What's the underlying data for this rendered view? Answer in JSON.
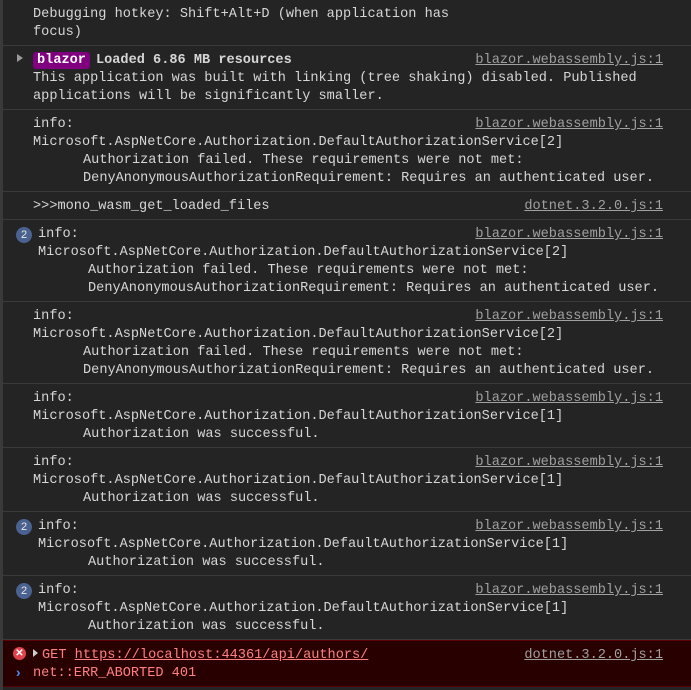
{
  "rows": [
    {
      "lines": [
        {
          "t": "Debugging hotkey: Shift+Alt+D (when application has"
        },
        {
          "t": "focus)"
        }
      ],
      "source": ""
    },
    {
      "expand": true,
      "tag": "blazor",
      "lines": [
        {
          "t": "Loaded 6.86 MB resources",
          "bold": true
        },
        {
          "t": "This application was built with linking (tree shaking) disabled. Published"
        },
        {
          "t": "applications will be significantly smaller."
        }
      ],
      "source": "blazor.webassembly.js:1"
    },
    {
      "lines": [
        {
          "t": "info:"
        },
        {
          "t": "Microsoft.AspNetCore.Authorization.DefaultAuthorizationService[2]"
        },
        {
          "t": "Authorization failed. These requirements were not met:",
          "i": true
        },
        {
          "t": "DenyAnonymousAuthorizationRequirement: Requires an authenticated user.",
          "i": true
        }
      ],
      "source": "blazor.webassembly.js:1"
    },
    {
      "lines": [
        {
          "t": ">>>mono_wasm_get_loaded_files"
        }
      ],
      "source": "dotnet.3.2.0.js:1"
    },
    {
      "count": "2",
      "lines": [
        {
          "t": "info:"
        },
        {
          "t": "Microsoft.AspNetCore.Authorization.DefaultAuthorizationService[2]"
        },
        {
          "t": "Authorization failed. These requirements were not met:",
          "i": true
        },
        {
          "t": "DenyAnonymousAuthorizationRequirement: Requires an authenticated user.",
          "i": true
        }
      ],
      "source": "blazor.webassembly.js:1"
    },
    {
      "lines": [
        {
          "t": "info:"
        },
        {
          "t": "Microsoft.AspNetCore.Authorization.DefaultAuthorizationService[2]"
        },
        {
          "t": "Authorization failed. These requirements were not met:",
          "i": true
        },
        {
          "t": "DenyAnonymousAuthorizationRequirement: Requires an authenticated user.",
          "i": true
        }
      ],
      "source": "blazor.webassembly.js:1"
    },
    {
      "lines": [
        {
          "t": "info:"
        },
        {
          "t": "Microsoft.AspNetCore.Authorization.DefaultAuthorizationService[1]"
        },
        {
          "t": "Authorization was successful.",
          "i": true
        }
      ],
      "source": "blazor.webassembly.js:1"
    },
    {
      "lines": [
        {
          "t": "info:"
        },
        {
          "t": "Microsoft.AspNetCore.Authorization.DefaultAuthorizationService[1]"
        },
        {
          "t": "Authorization was successful.",
          "i": true
        }
      ],
      "source": "blazor.webassembly.js:1"
    },
    {
      "count": "2",
      "lines": [
        {
          "t": "info:"
        },
        {
          "t": "Microsoft.AspNetCore.Authorization.DefaultAuthorizationService[1]"
        },
        {
          "t": "Authorization was successful.",
          "i": true
        }
      ],
      "source": "blazor.webassembly.js:1"
    },
    {
      "count": "2",
      "lines": [
        {
          "t": "info:"
        },
        {
          "t": "Microsoft.AspNetCore.Authorization.DefaultAuthorizationService[1]"
        },
        {
          "t": "Authorization was successful.",
          "i": true
        }
      ],
      "source": "blazor.webassembly.js:1"
    }
  ],
  "error": {
    "icon": "error-icon",
    "method": "GET",
    "url": "https://localhost:44361/api/authors/",
    "status": "net::ERR_ABORTED 401",
    "source": "dotnet.3.2.0.js:1"
  },
  "prompt": "›"
}
